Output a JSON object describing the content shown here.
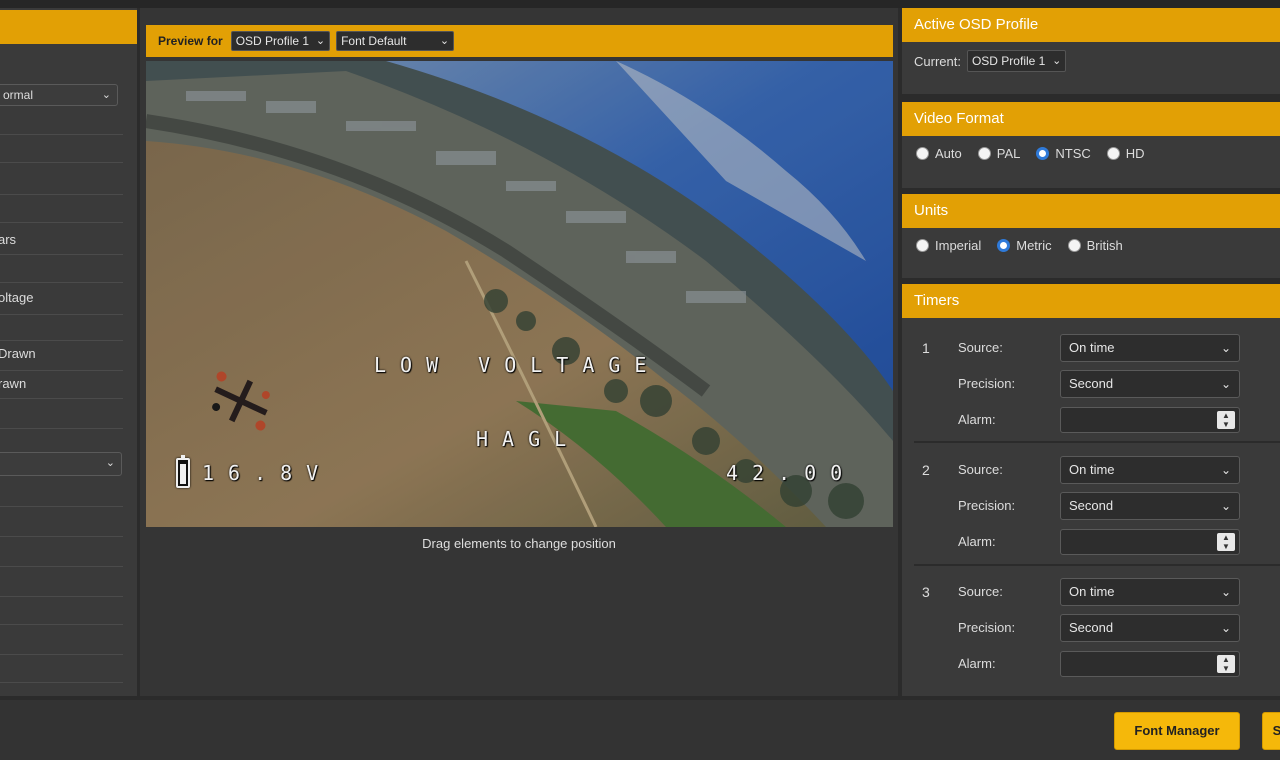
{
  "left_panel": {
    "select_top_value": "ormal",
    "rows": [
      "ars",
      "oltage",
      "Drawn",
      "rawn"
    ]
  },
  "center": {
    "preview_label": "Preview for",
    "profile_select": "OSD Profile 1",
    "font_select": "Font Default",
    "osd": {
      "warning": "LOW VOLTAGE",
      "hagl": "HAGL",
      "voltage": "16.8V",
      "distance": "42.00"
    },
    "drag_hint": "Drag elements to change position"
  },
  "right": {
    "active_profile": {
      "title": "Active OSD Profile",
      "current_label": "Current:",
      "current_value": "OSD Profile 1"
    },
    "video_format": {
      "title": "Video Format",
      "options": [
        "Auto",
        "PAL",
        "NTSC",
        "HD"
      ],
      "selected": "NTSC"
    },
    "units": {
      "title": "Units",
      "options": [
        "Imperial",
        "Metric",
        "British"
      ],
      "selected": "Metric"
    },
    "timers": {
      "title": "Timers",
      "source_label": "Source:",
      "precision_label": "Precision:",
      "alarm_label": "Alarm:",
      "items": [
        {
          "num": "1",
          "source": "On time",
          "precision": "Second"
        },
        {
          "num": "2",
          "source": "On time",
          "precision": "Second"
        },
        {
          "num": "3",
          "source": "On time",
          "precision": "Second"
        }
      ]
    }
  },
  "bottom": {
    "font_manager_label": "Font Manager",
    "save_label": "S"
  },
  "colors": {
    "accent": "#e2a005",
    "button": "#f5b80a",
    "panel": "#3a3a3a",
    "radio_checked": "#2f7ad9"
  }
}
